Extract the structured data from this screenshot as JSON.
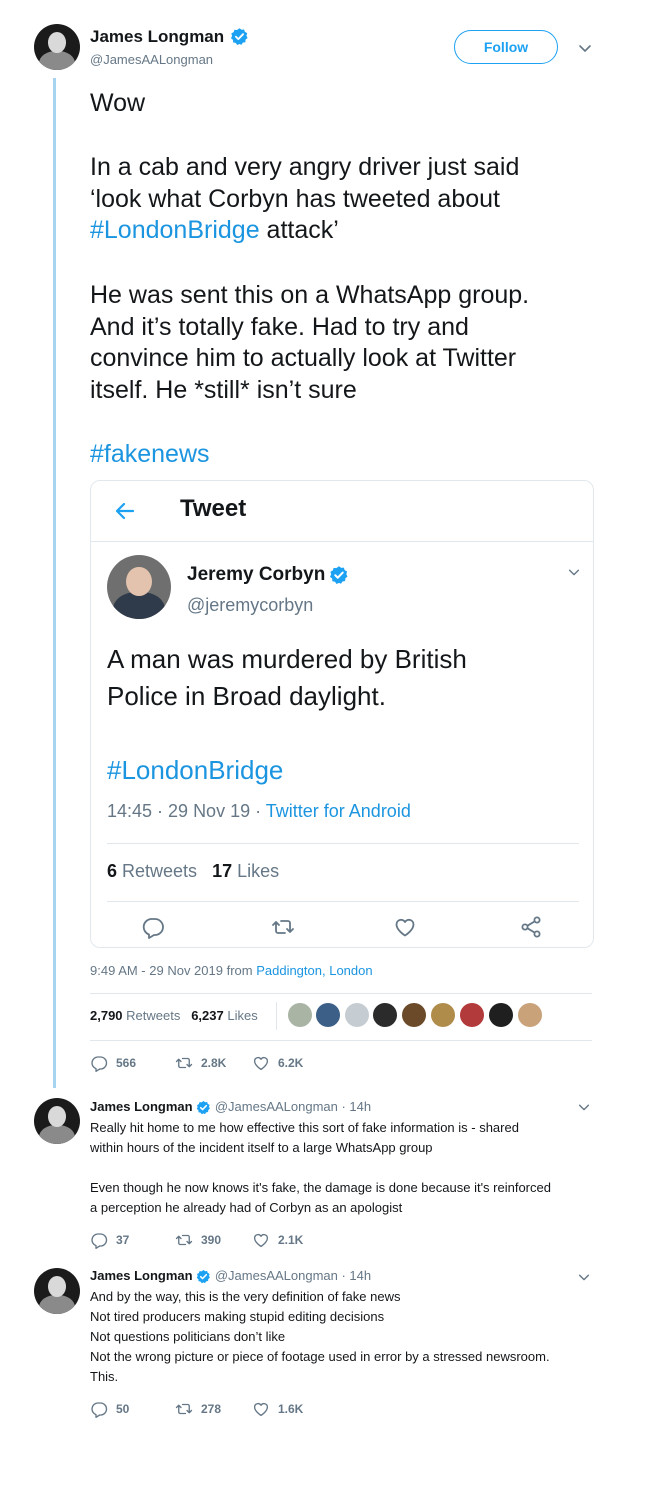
{
  "main_tweet": {
    "name": "James Longman",
    "handle": "@JamesAALongman",
    "follow_label": "Follow",
    "line1": "Wow",
    "p1_l1": "In a cab and very angry driver just said",
    "p1_l2": "‘look what Corbyn has tweeted about",
    "p1_hashtag": "#LondonBridge",
    "p1_after": " attack’",
    "p2_l1": "He was sent this on a WhatsApp group.",
    "p2_l2": "And it’s totally fake. Had to try and",
    "p2_l3": "convince him to actually look at Twitter",
    "p2_l4": "itself. He *still* isn’t sure",
    "hashtag2": "#fakenews",
    "timestamp": "9:49 AM - 29 Nov 2019 from ",
    "location": "Paddington, London",
    "retweets_num": "2,790",
    "retweets_label": " Retweets",
    "likes_num": "6,237",
    "likes_label": " Likes",
    "replies_count": "566",
    "retweet_count": "2.8K",
    "like_count": "6.2K"
  },
  "embedded": {
    "header": "Tweet",
    "name": "Jeremy Corbyn",
    "handle": "@jeremycorbyn",
    "text_l1": "A man was murdered by British",
    "text_l2": "Police in Broad daylight.",
    "hashtag": "#LondonBridge",
    "time": "14:45 · 29 Nov 19 · ",
    "source": "Twitter for Android",
    "retweets_num": "6",
    "retweets_label": " Retweets",
    "likes_num": "17",
    "likes_label": " Likes"
  },
  "reply1": {
    "name": "James Longman",
    "handle_time": "@JamesAALongman · 14h",
    "l1": "Really hit home to me how effective this sort of fake information is - shared",
    "l2": "within hours of the incident itself to a large WhatsApp group",
    "l3": "Even though he now knows it's fake, the damage is done because it's reinforced",
    "l4": "a perception he already had of Corbyn as an apologist",
    "replies": "37",
    "retweets": "390",
    "likes": "2.1K"
  },
  "reply2": {
    "name": "James Longman",
    "handle_time": "@JamesAALongman · 14h",
    "l1": "And by the way, this is the very definition of fake news",
    "l2": "Not tired producers making stupid editing decisions",
    "l3": "Not questions politicians don’t like",
    "l4": "Not the wrong picture or piece of footage used in error by a stressed newsroom.",
    "l5": "This.",
    "replies": "50",
    "retweets": "278",
    "likes": "1.6K"
  },
  "colors": {
    "accent": "#1da1f2",
    "link": "#1b95e0",
    "muted": "#657786",
    "thread_line": "#a6d3ef",
    "border": "#e1e8ed"
  },
  "icons": [
    "verified-badge-icon",
    "chevron-down-icon",
    "back-arrow-icon",
    "reply-icon",
    "retweet-icon",
    "like-icon",
    "share-icon"
  ]
}
